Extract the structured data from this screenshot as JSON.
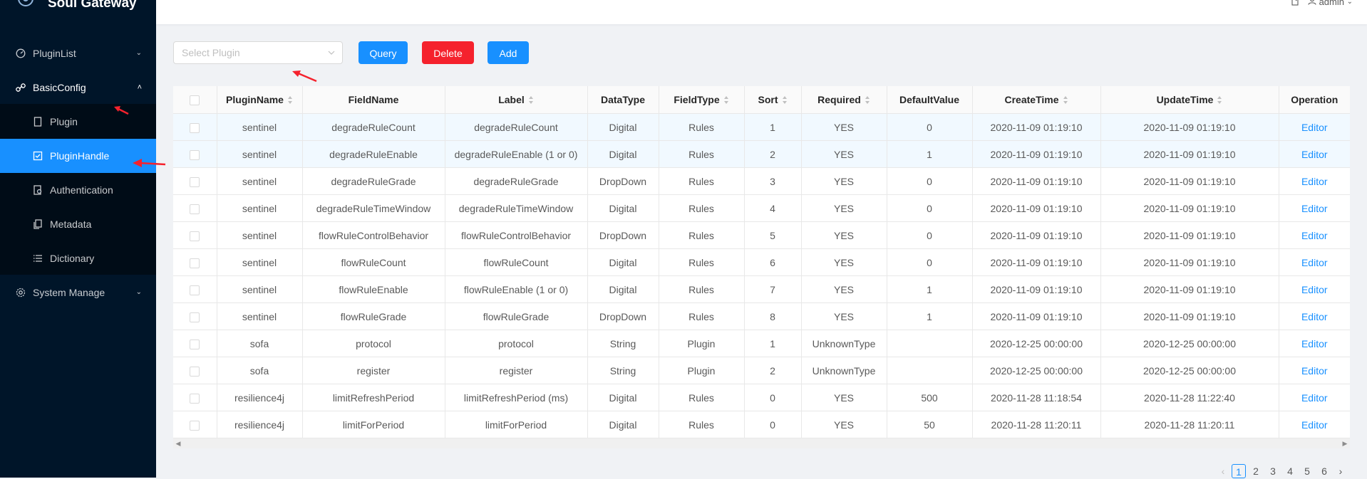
{
  "app": {
    "title": "Soul Gateway"
  },
  "header": {
    "user": "admin"
  },
  "sidebar": {
    "items": [
      {
        "label": "PluginList",
        "icon": "dashboard-icon"
      },
      {
        "label": "BasicConfig",
        "icon": "link-icon"
      },
      {
        "label": "Plugin",
        "icon": "file-icon"
      },
      {
        "label": "PluginHandle",
        "icon": "check-square-icon"
      },
      {
        "label": "Authentication",
        "icon": "audit-icon"
      },
      {
        "label": "Metadata",
        "icon": "copy-icon"
      },
      {
        "label": "Dictionary",
        "icon": "list-icon"
      },
      {
        "label": "System Manage",
        "icon": "setting-icon"
      }
    ]
  },
  "toolbar": {
    "select_placeholder": "Select Plugin",
    "query_label": "Query",
    "delete_label": "Delete",
    "add_label": "Add"
  },
  "table": {
    "columns": [
      "PluginName",
      "FieldName",
      "Label",
      "DataType",
      "FieldType",
      "Sort",
      "Required",
      "DefaultValue",
      "CreateTime",
      "UpdateTime",
      "Operation"
    ],
    "rows": [
      [
        "sentinel",
        "degradeRuleCount",
        "degradeRuleCount",
        "Digital",
        "Rules",
        "1",
        "YES",
        "0",
        "2020-11-09 01:19:10",
        "2020-11-09 01:19:10",
        "Editor"
      ],
      [
        "sentinel",
        "degradeRuleEnable",
        "degradeRuleEnable (1 or 0)",
        "Digital",
        "Rules",
        "2",
        "YES",
        "1",
        "2020-11-09 01:19:10",
        "2020-11-09 01:19:10",
        "Editor"
      ],
      [
        "sentinel",
        "degradeRuleGrade",
        "degradeRuleGrade",
        "DropDown",
        "Rules",
        "3",
        "YES",
        "0",
        "2020-11-09 01:19:10",
        "2020-11-09 01:19:10",
        "Editor"
      ],
      [
        "sentinel",
        "degradeRuleTimeWindow",
        "degradeRuleTimeWindow",
        "Digital",
        "Rules",
        "4",
        "YES",
        "0",
        "2020-11-09 01:19:10",
        "2020-11-09 01:19:10",
        "Editor"
      ],
      [
        "sentinel",
        "flowRuleControlBehavior",
        "flowRuleControlBehavior",
        "DropDown",
        "Rules",
        "5",
        "YES",
        "0",
        "2020-11-09 01:19:10",
        "2020-11-09 01:19:10",
        "Editor"
      ],
      [
        "sentinel",
        "flowRuleCount",
        "flowRuleCount",
        "Digital",
        "Rules",
        "6",
        "YES",
        "0",
        "2020-11-09 01:19:10",
        "2020-11-09 01:19:10",
        "Editor"
      ],
      [
        "sentinel",
        "flowRuleEnable",
        "flowRuleEnable (1 or 0)",
        "Digital",
        "Rules",
        "7",
        "YES",
        "1",
        "2020-11-09 01:19:10",
        "2020-11-09 01:19:10",
        "Editor"
      ],
      [
        "sentinel",
        "flowRuleGrade",
        "flowRuleGrade",
        "DropDown",
        "Rules",
        "8",
        "YES",
        "1",
        "2020-11-09 01:19:10",
        "2020-11-09 01:19:10",
        "Editor"
      ],
      [
        "sofa",
        "protocol",
        "protocol",
        "String",
        "Plugin",
        "1",
        "UnknownType",
        "",
        "2020-12-25 00:00:00",
        "2020-12-25 00:00:00",
        "Editor"
      ],
      [
        "sofa",
        "register",
        "register",
        "String",
        "Plugin",
        "2",
        "UnknownType",
        "",
        "2020-12-25 00:00:00",
        "2020-12-25 00:00:00",
        "Editor"
      ],
      [
        "resilience4j",
        "limitRefreshPeriod",
        "limitRefreshPeriod (ms)",
        "Digital",
        "Rules",
        "0",
        "YES",
        "500",
        "2020-11-28 11:18:54",
        "2020-11-28 11:22:40",
        "Editor"
      ],
      [
        "resilience4j",
        "limitForPeriod",
        "limitForPeriod",
        "Digital",
        "Rules",
        "0",
        "YES",
        "50",
        "2020-11-28 11:20:11",
        "2020-11-28 11:20:11",
        "Editor"
      ]
    ]
  },
  "pagination": {
    "pages": [
      "1",
      "2",
      "3",
      "4",
      "5",
      "6"
    ],
    "current": "1"
  },
  "colors": {
    "primary": "#1890ff",
    "danger": "#f5222d",
    "sidebar_bg": "#001529",
    "annotation": "#f5222d"
  }
}
